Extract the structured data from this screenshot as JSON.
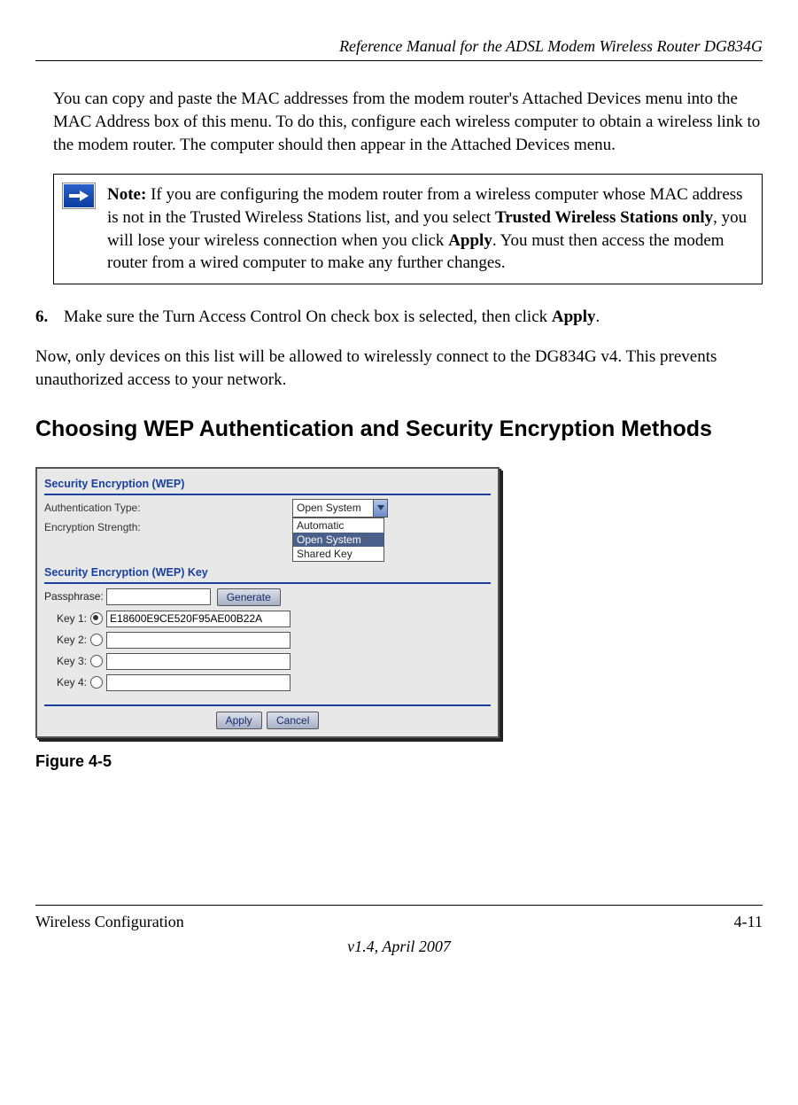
{
  "header": {
    "title": "Reference Manual for the ADSL Modem Wireless Router DG834G"
  },
  "intro_para": "You can copy and paste the MAC addresses from the modem router's Attached Devices menu into the MAC Address box of this menu. To do this, configure each wireless computer to obtain a wireless link to the modem router. The computer should then appear in the Attached Devices menu.",
  "note": {
    "label": "Note:",
    "text_1": " If you are configuring the modem router from a wireless computer whose MAC address is not in the Trusted Wireless Stations list, and you select ",
    "bold_1": "Trusted Wireless Stations only",
    "text_2": ", you will lose your wireless connection when you click ",
    "bold_2": "Apply",
    "text_3": ". You must then access the modem router from a wired computer to make any further changes."
  },
  "step": {
    "num": "6.",
    "text_1": "Make sure the Turn Access Control On check box is selected, then click ",
    "bold": "Apply",
    "text_2": "."
  },
  "after_para": "Now, only devices on this list will be allowed to wirelessly connect to the DG834G v4. This prevents unauthorized access to your network.",
  "heading": "Choosing WEP Authentication and Security Encryption Methods",
  "figure": {
    "section1_title": "Security Encryption (WEP)",
    "auth_label": "Authentication Type:",
    "auth_value": "Open System",
    "dropdown": {
      "opt1": "Automatic",
      "opt2": "Open System",
      "opt3": "Shared Key"
    },
    "enc_label": "Encryption Strength:",
    "section2_title": "Security Encryption (WEP) Key",
    "passphrase_label": "Passphrase:",
    "generate_btn": "Generate",
    "key1_label": "Key 1:",
    "key1_value": "E18600E9CE520F95AE00B22A",
    "key2_label": "Key 2:",
    "key3_label": "Key 3:",
    "key4_label": "Key 4:",
    "apply_btn": "Apply",
    "cancel_btn": "Cancel"
  },
  "figure_caption": "Figure 4-5",
  "footer": {
    "left": "Wireless Configuration",
    "right": "4-11",
    "center": "v1.4, April 2007"
  }
}
